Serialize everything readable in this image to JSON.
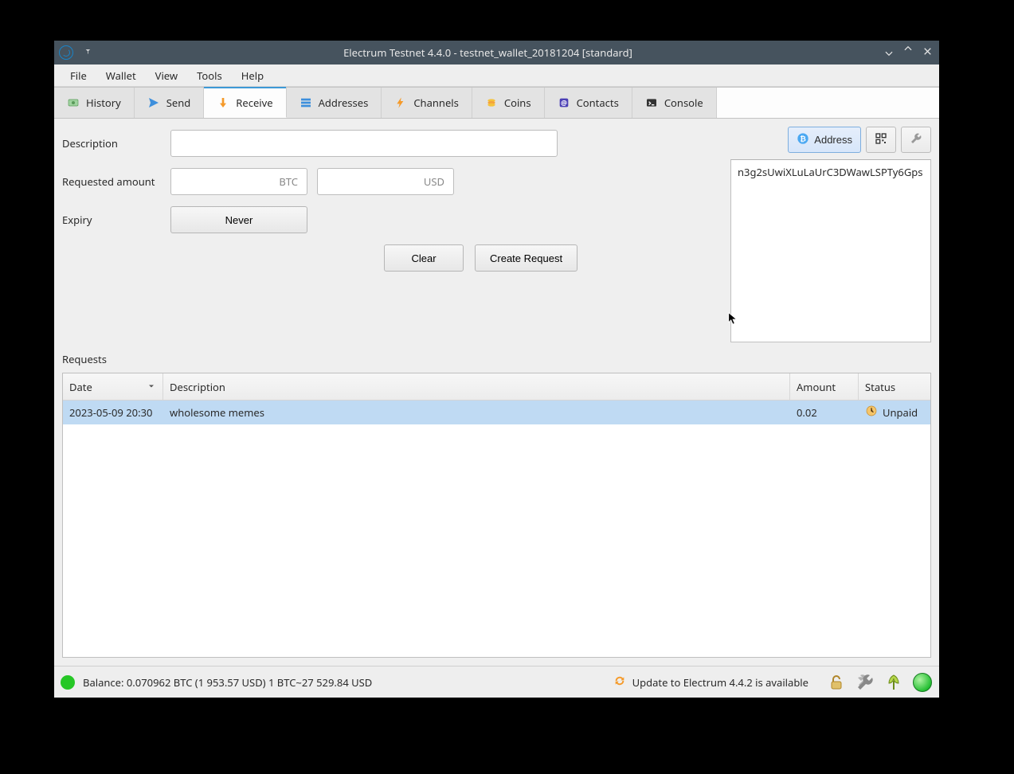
{
  "window": {
    "title": "Electrum Testnet 4.4.0 - testnet_wallet_20181204 [standard]"
  },
  "menubar": [
    "File",
    "Wallet",
    "View",
    "Tools",
    "Help"
  ],
  "tabs": [
    {
      "icon": "history-icon",
      "label": "History"
    },
    {
      "icon": "send-icon",
      "label": "Send"
    },
    {
      "icon": "receive-icon",
      "label": "Receive",
      "active": true
    },
    {
      "icon": "addresses-icon",
      "label": "Addresses"
    },
    {
      "icon": "channels-icon",
      "label": "Channels"
    },
    {
      "icon": "coins-icon",
      "label": "Coins"
    },
    {
      "icon": "contacts-icon",
      "label": "Contacts"
    },
    {
      "icon": "console-icon",
      "label": "Console"
    }
  ],
  "form": {
    "description_label": "Description",
    "description_value": "",
    "requested_amount_label": "Requested amount",
    "amount_btc_value": "",
    "amount_btc_unit": "BTC",
    "amount_usd_value": "",
    "amount_usd_unit": "USD",
    "expiry_label": "Expiry",
    "expiry_value": "Never",
    "clear_label": "Clear",
    "create_label": "Create Request"
  },
  "side": {
    "address_btn": "Address",
    "address_value": "n3g2sUwiXLuLaUrC3DWawLSPTy6Gps"
  },
  "requests": {
    "title": "Requests",
    "columns": {
      "date": "Date",
      "description": "Description",
      "amount": "Amount",
      "status": "Status"
    },
    "rows": [
      {
        "date": "2023-05-09 20:30",
        "description": "wholesome memes",
        "amount": "0.02",
        "status": "Unpaid"
      }
    ]
  },
  "statusbar": {
    "balance": "Balance: 0.070962 BTC (1 953.57 USD)  1 BTC~27 529.84 USD",
    "update": "Update to Electrum 4.4.2 is available"
  }
}
